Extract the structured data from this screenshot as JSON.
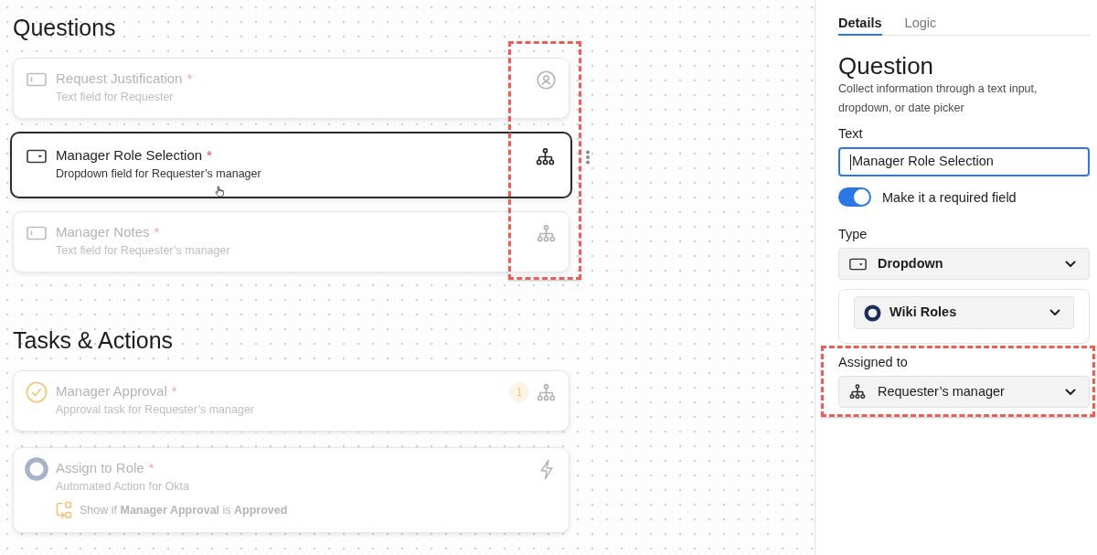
{
  "canvas": {
    "sections": [
      {
        "title": "Questions",
        "icons_highlighted": true,
        "items": [
          {
            "kind": "text",
            "title": "Request Justification",
            "required_mark": "*",
            "subtitle": "Text field for Requester",
            "assignee": {
              "kind": "requester"
            },
            "selected": false,
            "hovered": false
          },
          {
            "kind": "dropdown",
            "title": "Manager Role Selection",
            "required_mark": "*",
            "subtitle": "Dropdown field for Requester’s manager",
            "assignee": {
              "kind": "manager"
            },
            "selected": true,
            "hovered": true
          },
          {
            "kind": "text",
            "title": "Manager Notes",
            "required_mark": "*",
            "subtitle": "Text field for Requester’s manager",
            "assignee": {
              "kind": "manager"
            },
            "selected": false,
            "hovered": false
          }
        ]
      },
      {
        "title": "Tasks & Actions",
        "items": [
          {
            "kind": "approval",
            "title": "Manager Approval",
            "required_mark": "*",
            "subtitle": "Approval task for Requester’s manager",
            "badge": "1",
            "assignee": {
              "kind": "manager"
            },
            "selected": false,
            "hovered": false
          },
          {
            "kind": "action",
            "title": "Assign to Role",
            "required_mark": "*",
            "subtitle": "Automated Action for Okta",
            "assignee": {
              "kind": "automation"
            },
            "condition": "Show if **Manager Approval** is **Approved**",
            "selected": false,
            "hovered": false
          }
        ]
      }
    ]
  },
  "panel": {
    "tabs": [
      {
        "label": "Details",
        "selected": true
      },
      {
        "label": "Logic",
        "selected": false
      }
    ],
    "title": "Question",
    "description": "Collect information through a text input, dropdown, or date picker",
    "text_field": {
      "label": "Text",
      "value": "Manager Role Selection",
      "focused": true
    },
    "required_toggle": {
      "label": "Make it a required field",
      "on": true
    },
    "type": {
      "label": "Type",
      "value": "Dropdown",
      "source": "Wiki Roles"
    },
    "assigned_to": {
      "label": "Assigned to",
      "value": "Requester’s manager",
      "highlighted": true
    }
  }
}
